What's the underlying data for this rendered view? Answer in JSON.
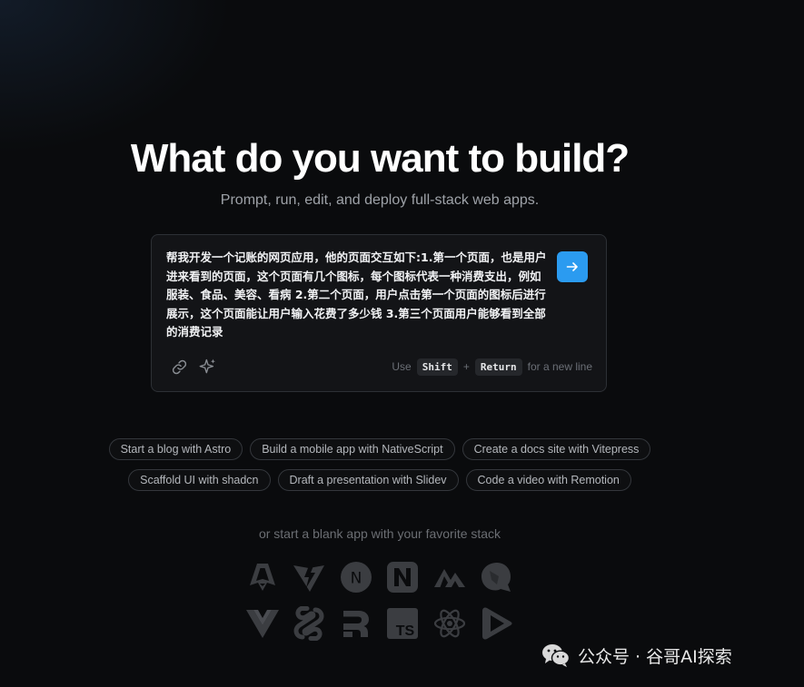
{
  "hero": {
    "title": "What do you want to build?",
    "subtitle": "Prompt, run, edit, and deploy full-stack web apps."
  },
  "prompt": {
    "text": "帮我开发一个记账的网页应用，他的页面交互如下:1.第一个页面，也是用户进来看到的页面，这个页面有几个图标，每个图标代表一种消费支出，例如服装、食品、美容、看病 2.第二个页面，用户点击第一个页面的图标后进行展示，这个页面能让用户输入花费了多少钱 3.第三个页面用户能够看到全部的消费记录",
    "hint_use": "Use",
    "hint_shift": "Shift",
    "hint_plus": "+",
    "hint_return": "Return",
    "hint_suffix": "for a new line"
  },
  "suggestions": {
    "row1": [
      "Start a blog with Astro",
      "Build a mobile app with NativeScript",
      "Create a docs site with Vitepress"
    ],
    "row2": [
      "Scaffold UI with shadcn",
      "Draft a presentation with Slidev",
      "Code a video with Remotion"
    ]
  },
  "stacks": {
    "label": "or start a blank app with your favorite stack",
    "row1": [
      "astro-icon",
      "vite-icon",
      "next-icon",
      "nuxt-icon",
      "analog-icon",
      "qwik-icon"
    ],
    "row2": [
      "vue-icon",
      "svelte-icon",
      "remix-icon",
      "typescript-icon",
      "react-icon",
      "remotion-icon"
    ],
    "ts_text": "TS",
    "next_text": "N"
  },
  "watermark": {
    "text": "公众号 · 谷哥AI探索"
  },
  "colors": {
    "accent": "#2b9bf0",
    "background": "#0a0b0d",
    "icon_gray": "#3b3d41"
  }
}
